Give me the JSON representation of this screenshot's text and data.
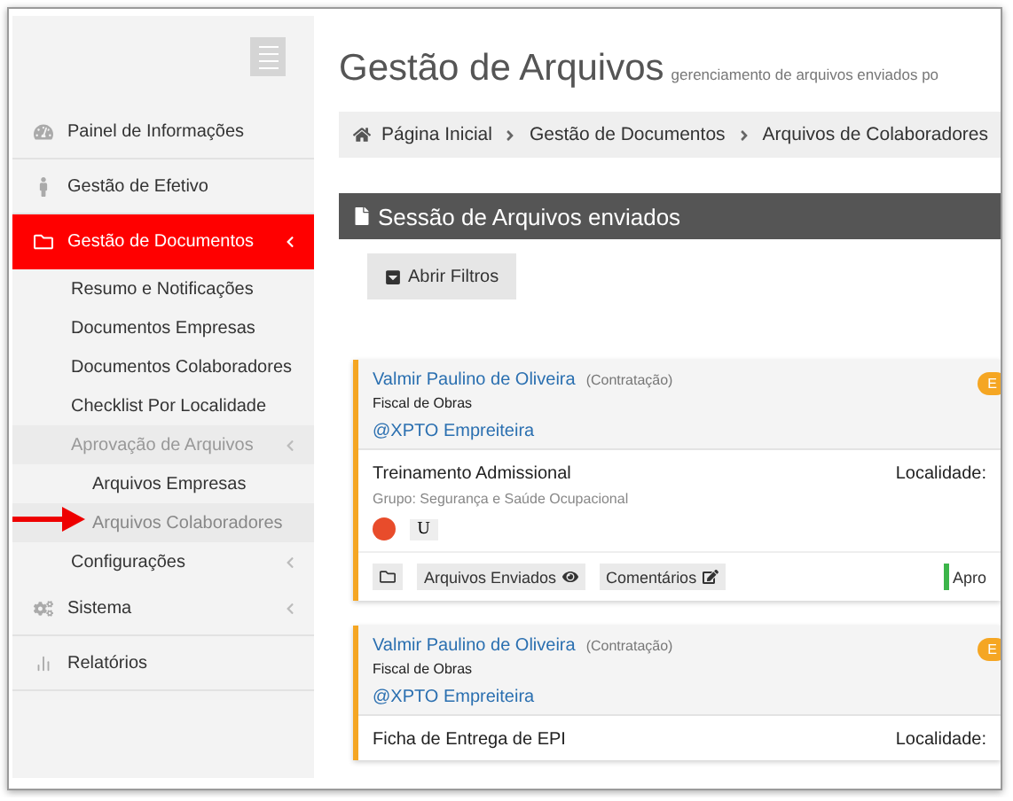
{
  "sidebar": {
    "items": [
      {
        "label": "Painel de Informações",
        "selected": false,
        "collapsible": false
      },
      {
        "label": "Gestão de Efetivo",
        "selected": false,
        "collapsible": false
      },
      {
        "label": "Gestão de Documentos",
        "selected": true,
        "collapsible": true,
        "children": [
          {
            "label": "Resumo e Notificações",
            "selected": false,
            "collapsible": false
          },
          {
            "label": "Documentos Empresas",
            "selected": false,
            "collapsible": false
          },
          {
            "label": "Documentos Colaboradores",
            "selected": false,
            "collapsible": false
          },
          {
            "label": "Checklist Por Localidade",
            "selected": false,
            "collapsible": false
          },
          {
            "label": "Aprovação de Arquivos",
            "selected": true,
            "collapsible": true,
            "children": [
              {
                "label": "Arquivos Empresas",
                "selected": false,
                "collapsible": false
              },
              {
                "label": "Arquivos Colaboradores",
                "selected": true,
                "collapsible": false
              }
            ]
          },
          {
            "label": "Configurações",
            "selected": false,
            "collapsible": true
          }
        ]
      },
      {
        "label": "Sistema",
        "selected": false,
        "collapsible": true
      },
      {
        "label": "Relatórios",
        "selected": false,
        "collapsible": false
      }
    ]
  },
  "page": {
    "title": "Gestão de Arquivos",
    "subtitle": "gerenciamento de arquivos enviados po"
  },
  "breadcrumb": [
    "Página Inicial",
    "Gestão de Documentos",
    "Arquivos de Colaboradores"
  ],
  "section": {
    "title": "Sessão de Arquivos enviados",
    "filter_button": "Abrir Filtros"
  },
  "cards": [
    {
      "name": "Valmir Paulino de Oliveira",
      "type": "(Contratação)",
      "role": "Fiscal de Obras",
      "company": "@XPTO Empreiteira",
      "badge": "E",
      "document": "Treinamento Admissional",
      "location": "Localidade:",
      "group": "Grupo: Segurança e Saúde Ocupacional",
      "color": "#e84c2b",
      "tag": "U",
      "actions": [
        "Arquivos Enviados",
        "Comentários"
      ],
      "approve": "Apro"
    },
    {
      "name": "Valmir Paulino de Oliveira",
      "type": "(Contratação)",
      "role": "Fiscal de Obras",
      "company": "@XPTO Empreiteira",
      "badge": "E",
      "document": "Ficha de Entrega de EPI",
      "location": "Localidade:"
    }
  ]
}
